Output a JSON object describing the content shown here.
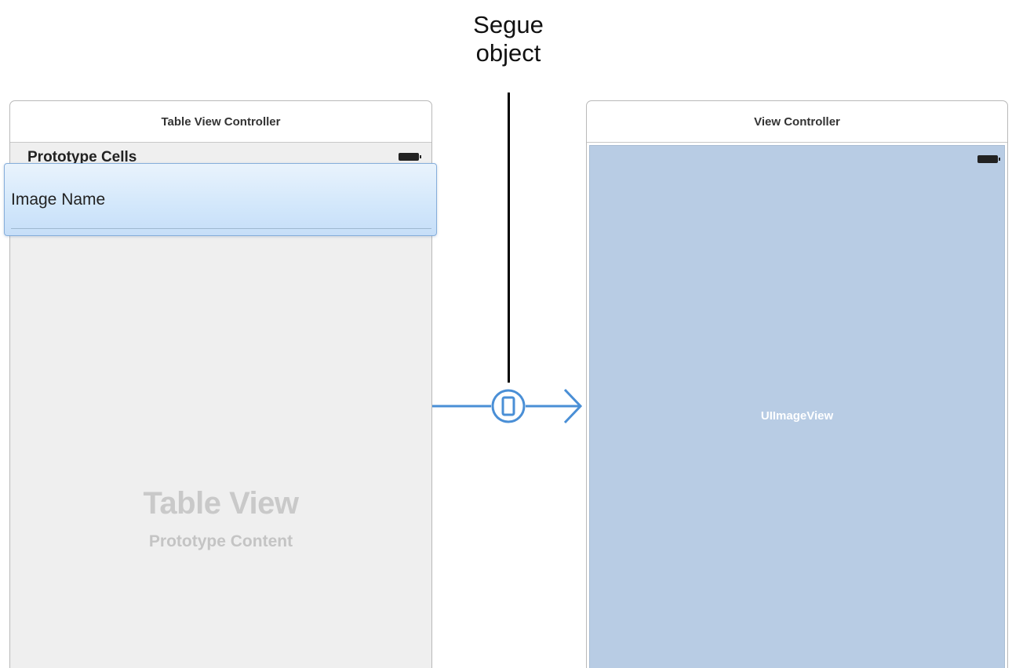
{
  "callout": {
    "line1": "Segue",
    "line2": "object"
  },
  "left_scene": {
    "title": "Table View Controller",
    "section_header": "Prototype Cells",
    "cell_label": "Image Name",
    "placeholder_title": "Table View",
    "placeholder_subtitle": "Prototype Content"
  },
  "right_scene": {
    "title": "View Controller",
    "image_view_label": "UIImageView"
  },
  "colors": {
    "segue": "#4a8fd6",
    "image_view_fill": "#b8cce4",
    "cell_highlight": "#d2e7fb"
  },
  "icons": {
    "segue": "segue-modal-icon",
    "battery": "battery-icon",
    "arrow": "arrow-right-icon"
  }
}
